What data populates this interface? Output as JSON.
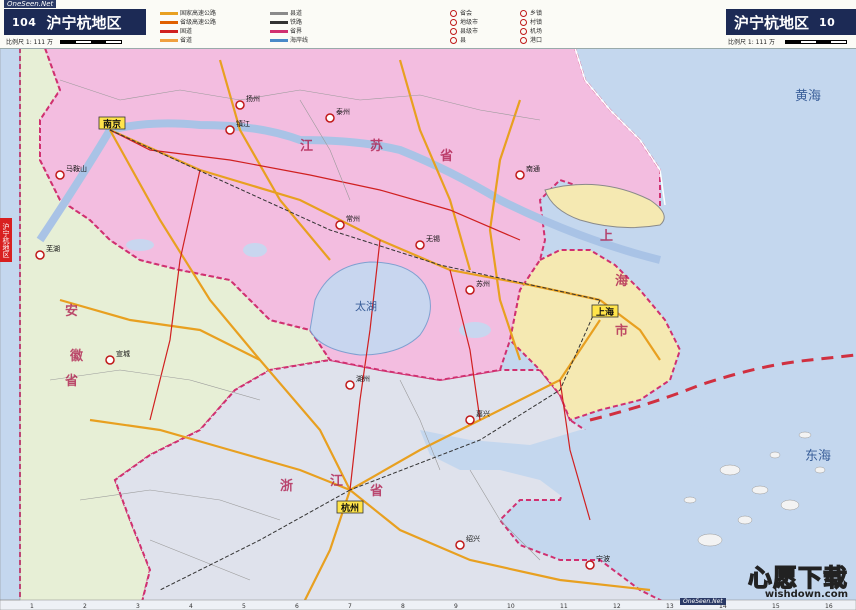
{
  "header": {
    "page_left": "104",
    "title_left": "沪宁杭地区",
    "page_right": "10",
    "title_right": "沪宁杭地区",
    "scale_left": "比例尺 1: 111 万",
    "scale_right": "比例尺 1: 111 万",
    "legend": [
      {
        "label": "国家高速公路",
        "color": "#e8a020"
      },
      {
        "label": "省级高速公路",
        "color": "#e06000"
      },
      {
        "label": "国道",
        "color": "#d02020"
      },
      {
        "label": "省道",
        "color": "#f0a040"
      },
      {
        "label": "县道",
        "color": "#8a8a8a"
      },
      {
        "label": "铁路",
        "color": "#333333"
      },
      {
        "label": "省界",
        "color": "#d03070"
      },
      {
        "label": "海岸线",
        "color": "#4a8ac8"
      }
    ],
    "legend_symbols": [
      "省会",
      "地级市",
      "县级市",
      "县",
      "乡镇",
      "村镇",
      "机场",
      "港口"
    ]
  },
  "side_tab": "沪宁杭地区",
  "cities": [
    {
      "name": "南京",
      "kind": "capital"
    },
    {
      "name": "上海",
      "kind": "capital"
    },
    {
      "name": "杭州",
      "kind": "capital"
    },
    {
      "name": "湖州",
      "kind": "city"
    },
    {
      "name": "嘉兴",
      "kind": "city"
    },
    {
      "name": "苏州",
      "kind": "city"
    },
    {
      "name": "无锡",
      "kind": "city"
    },
    {
      "name": "常州",
      "kind": "city"
    },
    {
      "name": "镇江",
      "kind": "city"
    },
    {
      "name": "扬州",
      "kind": "city"
    },
    {
      "name": "泰州",
      "kind": "city"
    },
    {
      "name": "南通",
      "kind": "city"
    },
    {
      "name": "马鞍山",
      "kind": "city"
    },
    {
      "name": "芜湖",
      "kind": "city"
    },
    {
      "name": "宣城",
      "kind": "city"
    },
    {
      "name": "宁波",
      "kind": "city"
    },
    {
      "name": "绍兴",
      "kind": "city"
    }
  ],
  "region_labels": [
    "江",
    "苏",
    "省",
    "上",
    "海",
    "市",
    "浙",
    "江",
    "省",
    "安",
    "徽",
    "省"
  ],
  "water_labels": [
    "太湖",
    "黄海",
    "东海"
  ],
  "watermark": {
    "big": "心愿下载",
    "small": "wishdown.com"
  },
  "logo": "OneSeen.Net",
  "colors": {
    "jiangsu": "#f3bde0",
    "shanghai": "#f5e9b2",
    "zhejiang": "#dfe2ec",
    "anhui": "#e7efd6",
    "sea": "#c4d7ee",
    "lake": "#c8d6ef",
    "expressway": "#e8a020",
    "national": "#d02020",
    "border": "#d03070"
  },
  "grid_cols": [
    "1",
    "2",
    "3",
    "4",
    "5",
    "6",
    "7",
    "8",
    "9",
    "10",
    "11",
    "12",
    "13",
    "14",
    "15",
    "16"
  ]
}
